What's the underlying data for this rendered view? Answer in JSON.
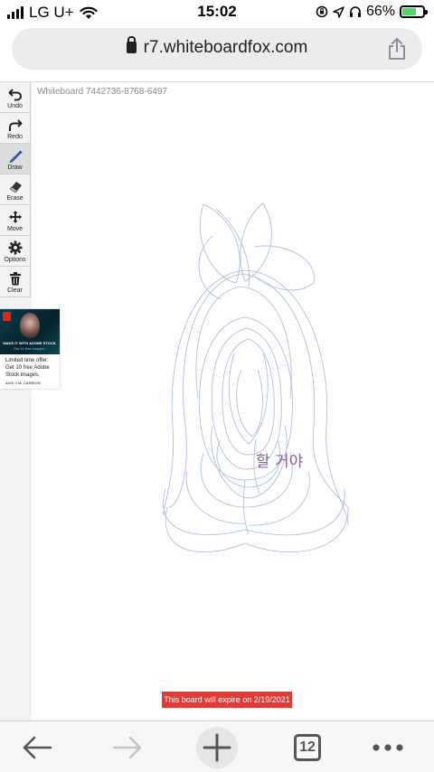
{
  "status_bar": {
    "carrier": "LG U+",
    "time": "15:02",
    "battery_percent": "66%",
    "battery_level": 0.66,
    "icons": [
      "signal-icon",
      "wifi-icon",
      "orientation-lock-icon",
      "location-icon",
      "headphones-icon",
      "battery-icon"
    ]
  },
  "browser": {
    "url": "r7.whiteboardfox.com"
  },
  "board": {
    "id_label": "Whiteboard 7442736-8768-6497",
    "expire_notice": "This board will expire on 2/19/2021",
    "handwriting": "할 거야",
    "colors": {
      "stroke": "#a9b8d6",
      "text": "#8e5fa4",
      "expire_bg": "#e53935"
    }
  },
  "toolbar": {
    "tools": [
      {
        "label": "Undo",
        "icon": "undo-icon"
      },
      {
        "label": "Redo",
        "icon": "redo-icon"
      },
      {
        "label": "Draw",
        "icon": "pencil-icon",
        "active": true
      },
      {
        "label": "Erase",
        "icon": "eraser-icon"
      },
      {
        "label": "Move",
        "icon": "move-icon"
      },
      {
        "label": "Options",
        "icon": "gear-icon"
      },
      {
        "label": "Clear",
        "icon": "trash-icon"
      }
    ]
  },
  "ad": {
    "headline": "MAKE IT WITH ADOBE STOCK.",
    "cta": "Get 10 free images ›",
    "body": "Limited time offer: Get 10 free Adobe Stock images.",
    "via": "ADS VIA CARBON"
  },
  "bottom_nav": {
    "tabs_count": "12",
    "icons": [
      "back-arrow-icon",
      "forward-arrow-icon",
      "plus-icon",
      "tabs-icon",
      "more-icon"
    ]
  }
}
